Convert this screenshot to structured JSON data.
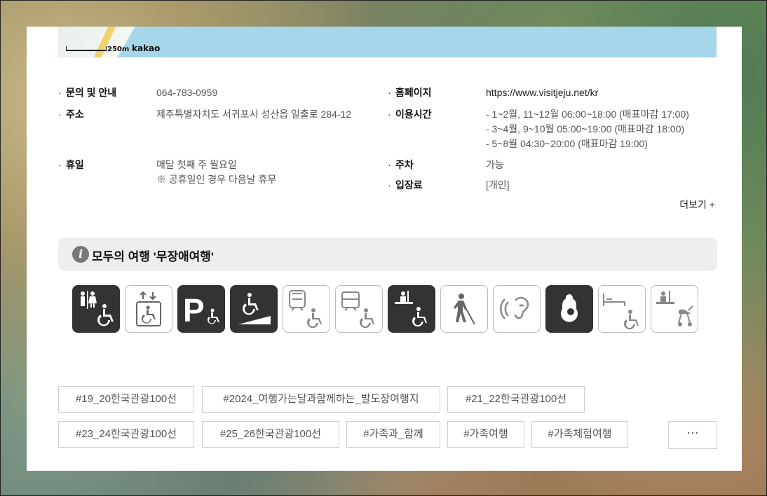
{
  "map": {
    "scale_label": "250m",
    "provider": "kakao"
  },
  "info": {
    "left": [
      {
        "label": "문의 및 안내",
        "value": "064-783-0959"
      },
      {
        "label": "주소",
        "value": "제주특별자치도 서귀포시 성산읍 일출로 284-12"
      },
      {
        "label": "휴일",
        "value": "매달 첫째 주 월요일\n※ 공휴일인 경우 다음날 휴무"
      }
    ],
    "right": [
      {
        "label": "홈페이지",
        "value": "https://www.visitjeju.net/kr"
      },
      {
        "label": "이용시간",
        "value": "- 1~2월, 11~12월 06:00~18:00 (매표마감 17:00)\n- 3~4월, 9~10월 05:00~19:00 (매표마감 18:00)\n- 5~8월 04:30~20:00 (매표마감 19:00)"
      },
      {
        "label": "주차",
        "value": "가능"
      },
      {
        "label": "입장료",
        "value": "[개인]"
      }
    ]
  },
  "more_label": "더보기 +",
  "accessibility": {
    "title": "모두의 여행 '무장애여행'",
    "icons": [
      {
        "name": "accessible-restroom-icon",
        "active": true
      },
      {
        "name": "accessible-elevator-icon",
        "active": false
      },
      {
        "name": "accessible-parking-icon",
        "active": true
      },
      {
        "name": "wheelchair-ramp-icon",
        "active": true
      },
      {
        "name": "accessible-subway-icon",
        "active": false
      },
      {
        "name": "accessible-bus-icon",
        "active": false
      },
      {
        "name": "accessible-ticket-counter-icon",
        "active": true
      },
      {
        "name": "visual-impairment-icon",
        "active": false
      },
      {
        "name": "hearing-impairment-icon",
        "active": false
      },
      {
        "name": "nursing-room-icon",
        "active": true
      },
      {
        "name": "accessible-room-icon",
        "active": false
      },
      {
        "name": "stroller-rental-icon",
        "active": false
      }
    ]
  },
  "tags": [
    "#19_20한국관광100선",
    "#2024_여행가는달과함께하는_발도장여행지",
    "#21_22한국관광100선",
    "#23_24한국관광100선",
    "#25_26한국관광100선",
    "#가족과_함께",
    "#가족여행",
    "#가족체험여행"
  ],
  "tags_more_label": "···"
}
